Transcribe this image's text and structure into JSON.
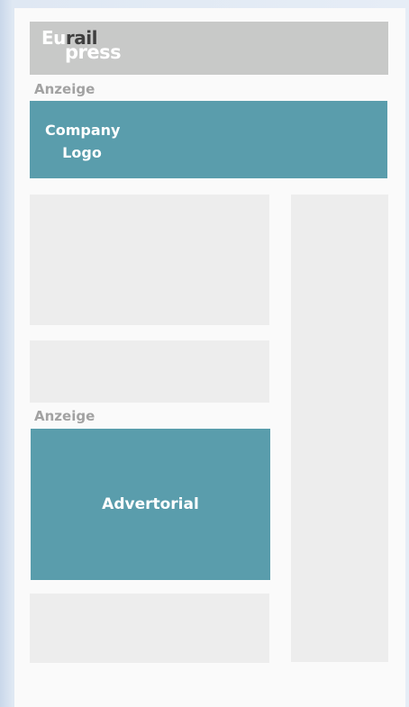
{
  "logo": {
    "part1": "Eu",
    "part2": "rail",
    "part3": "press"
  },
  "ad_label_top": "Anzeige",
  "company_logo": {
    "line1": "Company",
    "line2": "Logo"
  },
  "ad_label_mid": "Anzeige",
  "advertorial": "Advertorial",
  "colors": {
    "ad_block": "#5a9dac",
    "placeholder": "#ededed",
    "header": "#c8c9c8",
    "label": "#a2a2a2"
  }
}
